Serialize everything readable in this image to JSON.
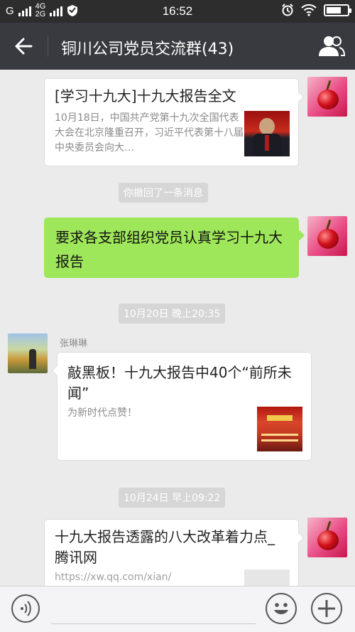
{
  "status_bar": {
    "carrier1": "G",
    "carrier2_top": "4G",
    "carrier2_bottom": "2G",
    "time": "16:52"
  },
  "header": {
    "title": "铜川公司党员交流群(43)"
  },
  "messages": {
    "m1": {
      "title": "[学习十九大]十九大报告全文",
      "desc": "10月18日，中国共产党第十九次全国代表大会在北京隆重召开，习近平代表第十八届中央委员会向大…"
    },
    "recall_notice": "你撤回了一条消息",
    "m2": {
      "text": "要求各支部组织党员认真学习十九大报告"
    },
    "time1": "10月20日 晚上20:35",
    "m3": {
      "sender": "张琳琳",
      "title": "敲黑板！十九大报告中40个“前所未闻”",
      "desc": "为新时代点赞！"
    },
    "time2": "10月24日 早上09:22",
    "m4": {
      "title": "十九大报告透露的八大改革着力点_腾讯网",
      "desc": "https://xw.qq.com/xian/"
    }
  },
  "colors": {
    "header_bg": "#393a3f",
    "chat_bg": "#ebebeb",
    "bubble_green": "#9fe75a"
  },
  "icons": [
    "back-arrow-icon",
    "group-members-icon",
    "voice-icon",
    "emoji-icon",
    "plus-icon",
    "alarm-icon",
    "wifi-icon",
    "shield-icon",
    "battery-icon",
    "signal-icon"
  ]
}
